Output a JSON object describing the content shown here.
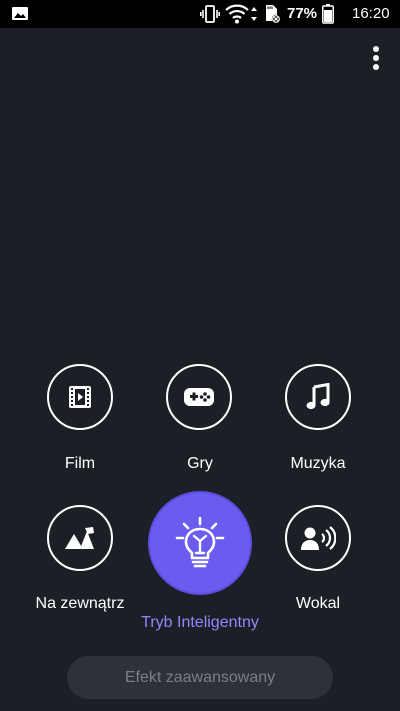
{
  "status_bar": {
    "battery_text": "77%",
    "time": "16:20",
    "icons": [
      "image-icon",
      "vibrate-icon",
      "wifi-icon",
      "sd-card-icon",
      "battery-icon"
    ]
  },
  "header": {
    "menu_icon": "more-vert-icon"
  },
  "modes": [
    {
      "label": "Film",
      "icon": "film-icon"
    },
    {
      "label": "Gry",
      "icon": "gamepad-icon"
    },
    {
      "label": "Muzyka",
      "icon": "music-note-icon"
    },
    {
      "label": "Na zewnątrz",
      "icon": "outdoor-icon"
    },
    {
      "label": "Tryb Inteligentny",
      "icon": "lightbulb-icon",
      "selected": true
    },
    {
      "label": "Wokal",
      "icon": "vocal-icon"
    }
  ],
  "advanced_button": {
    "label": "Efekt zaawansowany"
  },
  "colors": {
    "background": "#1c2026",
    "status_bar": "#000000",
    "accent": "#6b5cf0",
    "accent_text": "#8f88ff",
    "button_bg": "#2d3138",
    "button_text": "#7a7e85"
  }
}
